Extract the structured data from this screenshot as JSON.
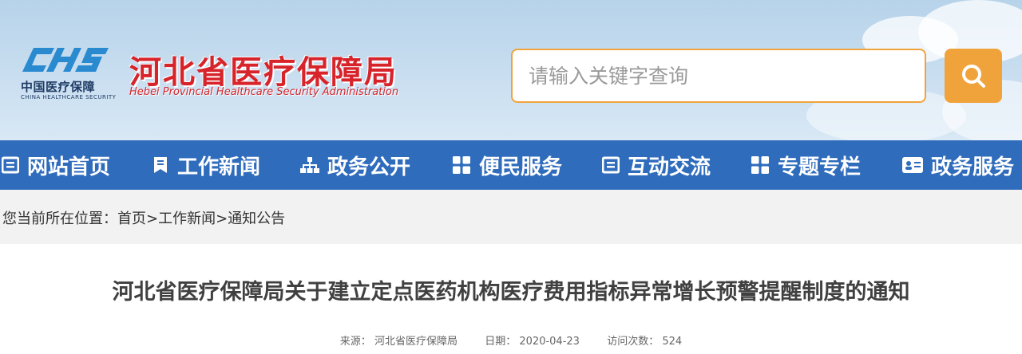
{
  "header": {
    "logo_mark": "CHS",
    "logo_cn_small": "中国医疗保障",
    "logo_en_small": "CHINA HEALTHCARE SECURITY",
    "site_title": "河北省医疗保障局",
    "site_subtitle": "Hebei Provincial Healthcare Security Administration",
    "brand_color": "#d7242b"
  },
  "search": {
    "placeholder": "请输入关键字查询",
    "button_icon": "search-icon",
    "accent_color": "#f1a33b"
  },
  "nav": {
    "background": "#2f6cbc",
    "items": [
      {
        "label": "网站首页",
        "icon": "list-icon"
      },
      {
        "label": "工作新闻",
        "icon": "bookmark-icon"
      },
      {
        "label": "政务公开",
        "icon": "sitemap-icon"
      },
      {
        "label": "便民服务",
        "icon": "grid-icon"
      },
      {
        "label": "互动交流",
        "icon": "list-icon"
      },
      {
        "label": "专题专栏",
        "icon": "grid-icon"
      },
      {
        "label": "政务服务",
        "icon": "id-card-icon"
      }
    ]
  },
  "breadcrumb": {
    "prefix": "您当前所在位置：",
    "items": [
      "首页",
      "工作新闻",
      "通知公告"
    ],
    "separator": ">"
  },
  "article": {
    "title": "河北省医疗保障局关于建立定点医药机构医疗费用指标异常增长预警提醒制度的通知",
    "source_label": "来源：",
    "source": "河北省医疗保障局",
    "date_label": "日期：",
    "date": "2020-04-23",
    "views_label": "访问次数：",
    "views": "524"
  }
}
